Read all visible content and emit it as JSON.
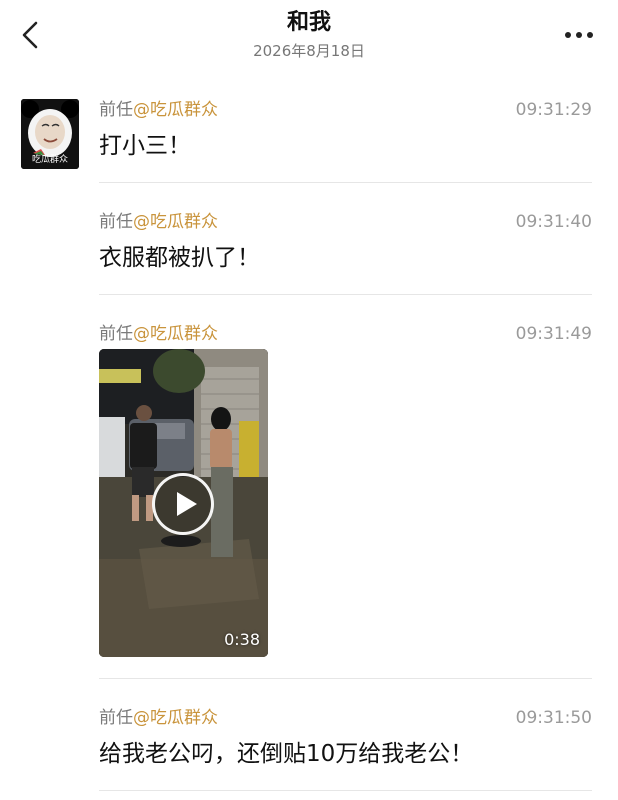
{
  "header": {
    "title": "和我",
    "date": "2026年8月18日",
    "back_icon": "chevron-left-icon",
    "more_icon": "more-horizontal-icon"
  },
  "avatar": {
    "caption": "吃瓜群众"
  },
  "messages": [
    {
      "prefix": "前任",
      "handle": "@吃瓜群众",
      "time": "09:31:29",
      "text": "打小三！"
    },
    {
      "prefix": "前任",
      "handle": "@吃瓜群众",
      "time": "09:31:40",
      "text": "衣服都被扒了！"
    },
    {
      "prefix": "前任",
      "handle": "@吃瓜群众",
      "time": "09:31:49",
      "video": {
        "duration": "0:38",
        "play_icon": "play-icon"
      }
    },
    {
      "prefix": "前任",
      "handle": "@吃瓜群众",
      "time": "09:31:50",
      "text": "给我老公叼，还倒贴10万给我老公！"
    }
  ],
  "colors": {
    "handle": "#c9943c",
    "time": "#9a9a9a",
    "divider": "#e6e6e6"
  }
}
